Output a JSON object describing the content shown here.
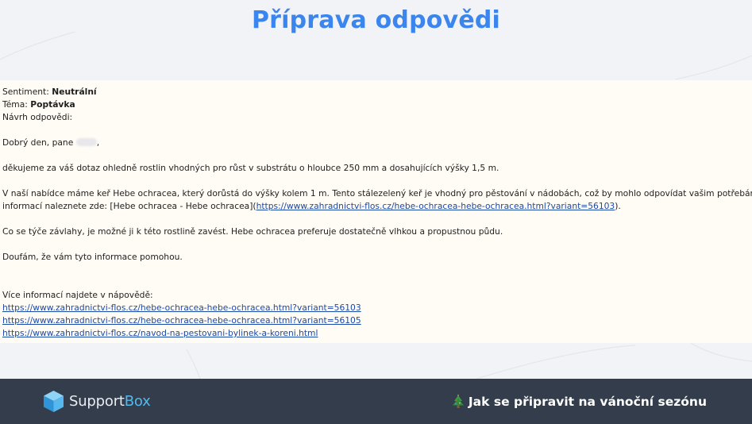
{
  "header": {
    "title": "Příprava odpovědi"
  },
  "email": {
    "sentiment_label": "Sentiment:",
    "sentiment_value": "Neutrální",
    "topic_label": "Téma:",
    "topic_value": "Poptávka",
    "draft_label": "Návrh odpovědi:",
    "greeting_start": "Dobrý den, pane",
    "greeting_end": ",",
    "para1": "děkujeme za váš dotaz ohledně rostlin vhodných pro růst v substrátu o hloubce 250 mm a dosahujících výšky 1,5 m.",
    "para2_line1": "V naší nabídce máme keř Hebe ochracea, který dorůstá do výšky kolem 1 m. Tento stálezelený keř je vhodný pro pěstování v nádobách, což by mohlo odpovídat vašim potřebám. Více",
    "para2_line2_start": "informací naleznete zde: [Hebe ochracea - Hebe ochracea](",
    "para2_link": "https://www.zahradnictvi-flos.cz/hebe-ochracea-hebe-ochracea.html?variant=56103",
    "para2_line2_end": ").",
    "para3": "Co se týče závlahy, je možné ji k této rostlině zavést. Hebe ochracea preferuje dostatečně vlhkou a propustnou půdu.",
    "para4": "Doufám, že vám tyto informace pomohou.",
    "more_info_label": "Více informací najdete v nápovědě:",
    "links": [
      "https://www.zahradnictvi-flos.cz/hebe-ochracea-hebe-ochracea.html?variant=56103",
      "https://www.zahradnictvi-flos.cz/hebe-ochracea-hebe-ochracea.html?variant=56105",
      "https://www.zahradnictvi-flos.cz/navod-na-pestovani-bylinek-a-koreni.html"
    ]
  },
  "footer": {
    "logo_text_support": "Support",
    "logo_text_box": "Box",
    "logo_icon": "cube-icon",
    "promo_icon": "christmas-tree-icon",
    "promo_text": "Jak se připravit na vánoční sezónu"
  },
  "colors": {
    "title": "#3a86ee",
    "page_background": "#f1f3f6",
    "panel_background": "#fffcf5",
    "footer_background": "#333d4b",
    "link": "#1b49a8",
    "logo_accent": "#53b9ef"
  }
}
